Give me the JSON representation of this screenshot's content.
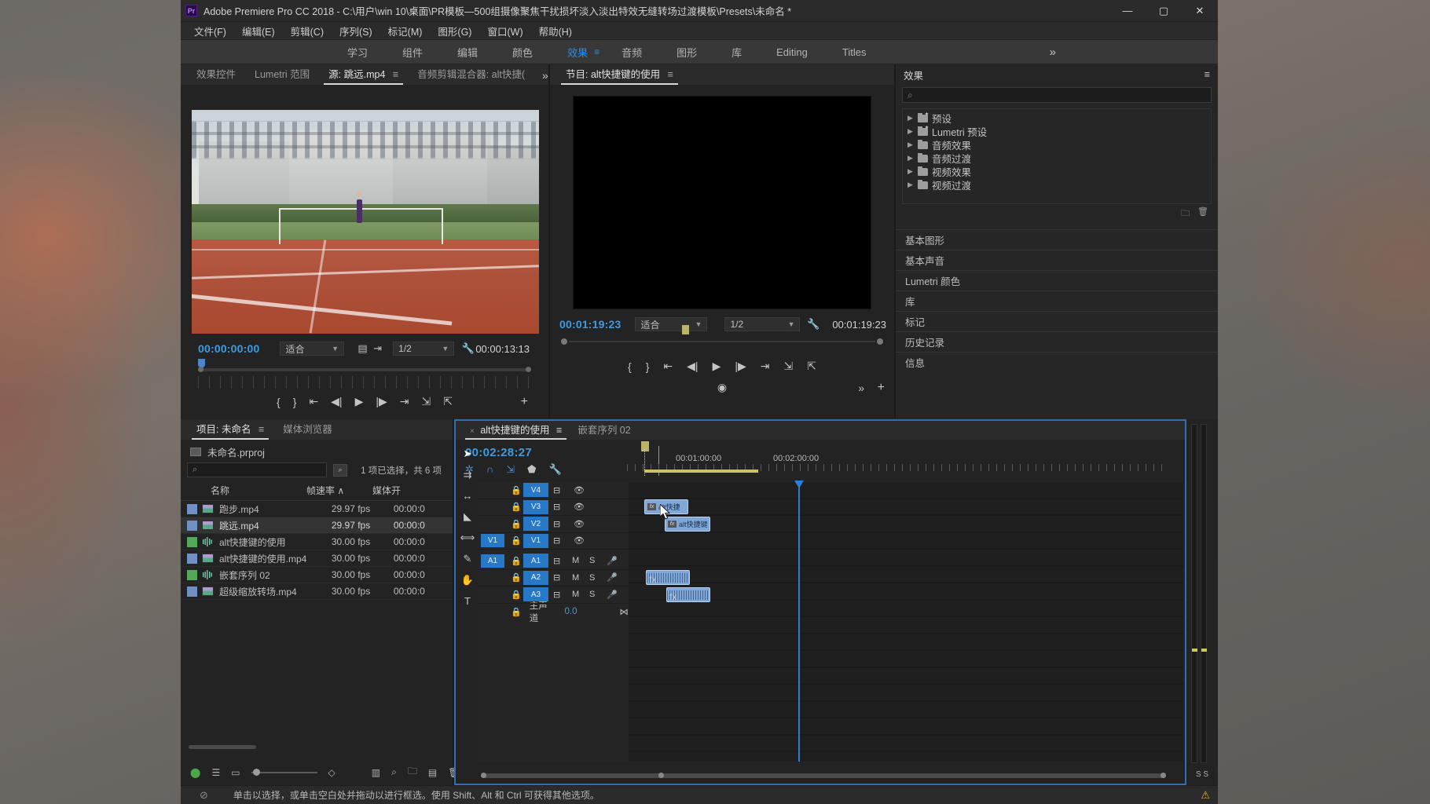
{
  "window": {
    "title": "Adobe Premiere Pro CC 2018 - C:\\用户\\win 10\\桌面\\PR模板—500组摄像聚焦干扰损坏淡入淡出特效无缝转场过渡模板\\Presets\\未命名 *",
    "logo": "Pr",
    "minimize": "—",
    "maximize": "▢",
    "close": "✕"
  },
  "menubar": {
    "items": [
      "文件(F)",
      "编辑(E)",
      "剪辑(C)",
      "序列(S)",
      "标记(M)",
      "图形(G)",
      "窗口(W)",
      "帮助(H)"
    ]
  },
  "workspace": {
    "items": [
      {
        "label": "学习",
        "active": false
      },
      {
        "label": "组件",
        "active": false
      },
      {
        "label": "编辑",
        "active": false
      },
      {
        "label": "颜色",
        "active": false
      },
      {
        "label": "效果",
        "active": true
      },
      {
        "label": "音频",
        "active": false
      },
      {
        "label": "图形",
        "active": false
      },
      {
        "label": "库",
        "active": false
      },
      {
        "label": "Editing",
        "active": false
      },
      {
        "label": "Titles",
        "active": false
      }
    ],
    "menu_icon": "≡",
    "more": "»"
  },
  "source_panel": {
    "tabs": [
      {
        "label": "效果控件",
        "active": false
      },
      {
        "label": "Lumetri 范围",
        "active": false
      },
      {
        "label": "源: 跳远.mp4",
        "active": true,
        "menu": "≡"
      },
      {
        "label": "音频剪辑混合器: alt快捷(",
        "active": false
      }
    ],
    "more": "»",
    "timecode_left": "00:00:00:00",
    "fit_label": "适合",
    "resolution_label": "1/2",
    "timecode_right": "00:00:13:13",
    "icons": [
      "export-frame-icon",
      "drag-icon",
      "wrench-icon"
    ],
    "transport": [
      "mark-in-icon",
      "mark-out-icon",
      "go-to-in-icon",
      "step-back-icon",
      "play-icon",
      "step-forward-icon",
      "go-to-out-icon",
      "insert-icon",
      "overwrite-icon",
      "add-button-icon"
    ]
  },
  "program_panel": {
    "tab": "节目: alt快捷键的使用",
    "menu": "≡",
    "timecode_left": "00:01:19:23",
    "fit_label": "适合",
    "resolution_label": "1/2",
    "timecode_right": "00:01:19:23",
    "more": "»",
    "add_btn": "+",
    "transport": [
      "mark-in-icon",
      "mark-out-icon",
      "go-to-in-icon",
      "step-back-icon",
      "play-icon",
      "step-forward-icon",
      "go-to-out-icon",
      "lift-icon",
      "extract-icon"
    ],
    "camera_icon": "export-frame-icon"
  },
  "effects_panel": {
    "title": "效果",
    "menu": "≡",
    "search_placeholder": "",
    "search_value": "",
    "tree": [
      {
        "label": "预设",
        "type": "preset-folder"
      },
      {
        "label": "Lumetri 预设",
        "type": "preset-folder"
      },
      {
        "label": "音频效果",
        "type": "folder"
      },
      {
        "label": "音频过渡",
        "type": "folder"
      },
      {
        "label": "视频效果",
        "type": "folder"
      },
      {
        "label": "视频过渡",
        "type": "folder"
      }
    ],
    "footer_icons": [
      "new-folder-icon",
      "delete-icon"
    ],
    "accordions": [
      "基本图形",
      "基本声音",
      "Lumetri 颜色",
      "库",
      "标记",
      "历史记录",
      "信息"
    ]
  },
  "project_panel": {
    "tabs": [
      {
        "label": "项目: 未命名",
        "active": true,
        "menu": "≡"
      },
      {
        "label": "媒体浏览器",
        "active": false
      }
    ],
    "file_name": "未命名.prproj",
    "search_placeholder": "",
    "selection_text": "1 项已选择，共 6 项",
    "columns": [
      "名称",
      "帧速率",
      "媒体开"
    ],
    "sort_indicator": "∧",
    "rows": [
      {
        "name": "跑步.mp4",
        "fps": "29.97 fps",
        "media_start": "00:00:0",
        "color": "#6f91c6",
        "kind": "video",
        "selected": false
      },
      {
        "name": "跳远.mp4",
        "fps": "29.97 fps",
        "media_start": "00:00:0",
        "color": "#6f91c6",
        "kind": "video",
        "selected": true
      },
      {
        "name": "alt快捷键的使用",
        "fps": "30.00 fps",
        "media_start": "00:00:0",
        "color": "#54a85a",
        "kind": "sequence",
        "selected": false
      },
      {
        "name": "alt快捷键的使用.mp4",
        "fps": "30.00 fps",
        "media_start": "00:00:0",
        "color": "#6f91c6",
        "kind": "video",
        "selected": false
      },
      {
        "name": "嵌套序列 02",
        "fps": "30.00 fps",
        "media_start": "00:00:0",
        "color": "#54a85a",
        "kind": "sequence",
        "selected": false
      },
      {
        "name": "超级缩放转场.mp4",
        "fps": "30.00 fps",
        "media_start": "00:00:0",
        "color": "#6f91c6",
        "kind": "video",
        "selected": false
      }
    ],
    "footer_icons": [
      "lock-icon",
      "list-view-icon",
      "icon-view-icon",
      "zoom-slider",
      "sort-icon",
      "freeform-icon",
      "find-icon",
      "new-bin-icon",
      "new-item-icon",
      "delete-icon"
    ]
  },
  "timeline_panel": {
    "tabs": [
      {
        "label": "alt快捷键的使用",
        "active": true,
        "close": "×",
        "menu": "≡"
      },
      {
        "label": "嵌套序列 02",
        "active": false
      }
    ],
    "playhead_timecode": "00:02:28:27",
    "tool_icons": [
      "snap-alt-icon",
      "magnet-icon",
      "linked-selection-icon",
      "marker-icon",
      "wrench-icon"
    ],
    "ruler_labels": [
      "00:01:00:00",
      "00:02:00:00"
    ],
    "tools": [
      "selection-tool",
      "track-select-tool",
      "ripple-edit-tool",
      "razor-tool",
      "slip-tool",
      "pen-tool",
      "hand-tool",
      "type-tool"
    ],
    "tracks": [
      {
        "name": "V4",
        "type": "video",
        "source_toggle": "",
        "lock": "lock-icon",
        "sync": "sync-icon",
        "eye": "eye-icon"
      },
      {
        "name": "V3",
        "type": "video",
        "source_toggle": "",
        "lock": "lock-icon",
        "sync": "sync-icon",
        "eye": "eye-icon"
      },
      {
        "name": "V2",
        "type": "video",
        "source_toggle": "",
        "lock": "lock-icon",
        "sync": "sync-icon",
        "eye": "eye-icon"
      },
      {
        "name": "V1",
        "type": "video",
        "source_toggle": "V1",
        "lock": "lock-icon",
        "sync": "sync-icon",
        "eye": "eye-icon"
      },
      {
        "name": "A1",
        "type": "audio",
        "source_toggle": "A1",
        "lock": "lock-icon",
        "sync": "sync-icon",
        "mute": "M",
        "solo": "S",
        "rec": "mic-icon"
      },
      {
        "name": "A2",
        "type": "audio",
        "source_toggle": "",
        "lock": "lock-icon",
        "sync": "sync-icon",
        "mute": "M",
        "solo": "S",
        "rec": "mic-icon"
      },
      {
        "name": "A3",
        "type": "audio",
        "source_toggle": "",
        "lock": "lock-icon",
        "sync": "sync-icon",
        "mute": "M",
        "solo": "S",
        "rec": "mic-icon"
      }
    ],
    "master_track": {
      "label": "主声道",
      "value": "0.0",
      "icon": "meter-icon"
    },
    "clips": [
      {
        "track": "V3",
        "label": "alt快捷",
        "fx": "fx"
      },
      {
        "track": "V2",
        "label": "alt快捷键",
        "fx": "fx"
      },
      {
        "track": "A1",
        "label": "",
        "fx": "fx"
      },
      {
        "track": "A2",
        "label": "",
        "fx": "fx"
      }
    ],
    "audio_meter_label": "S S"
  },
  "statusbar": {
    "icon": "no-drop-icon",
    "message": "单击以选择，或单击空白处并拖动以进行框选。使用 Shift、Alt 和 Ctrl 可获得其他选项。",
    "warning": "⚠"
  }
}
